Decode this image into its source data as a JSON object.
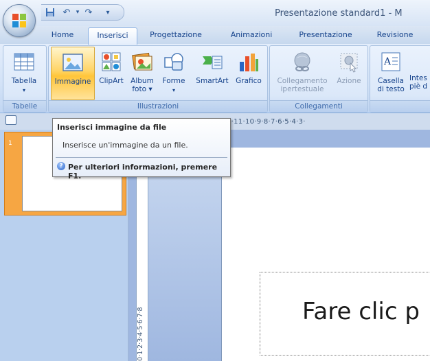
{
  "window": {
    "title": "Presentazione standard1 - M"
  },
  "tabs": [
    {
      "label": "Home"
    },
    {
      "label": "Inserisci",
      "active": true
    },
    {
      "label": "Progettazione"
    },
    {
      "label": "Animazioni"
    },
    {
      "label": "Presentazione"
    },
    {
      "label": "Revisione"
    }
  ],
  "ribbon": {
    "groups": {
      "tabelle": {
        "label": "Tabelle",
        "buttons": {
          "tabella": "Tabella"
        }
      },
      "illustrazioni": {
        "label": "Illustrazioni",
        "buttons": {
          "immagine": "Immagine",
          "clipart": "ClipArt",
          "album_1": "Album",
          "album_2": "foto ▾",
          "forme": "Forme",
          "smartart": "SmartArt",
          "grafico": "Grafico"
        }
      },
      "collegamenti": {
        "label": "Collegamenti",
        "buttons": {
          "collegamento_1": "Collegamento",
          "collegamento_2": "ipertestuale",
          "azione": "Azione"
        }
      },
      "testo": {
        "buttons": {
          "casella_1": "Casella",
          "casella_2": "di testo",
          "intest_1": "Intes",
          "intest_2": "piè d"
        }
      }
    }
  },
  "ruler": {
    "horizontal": "2·11·10·9·8·7·6·5·4·3·",
    "vertical": "0·1·2·3·4·5·6·7·8"
  },
  "slides_panel": {
    "slide_number": "1"
  },
  "slide": {
    "title_placeholder": "Fare clic p"
  },
  "tooltip": {
    "title": "Inserisci immagine da file",
    "description": "Inserisce un'immagine da un file.",
    "help": "Per ulteriori informazioni, premere F1."
  },
  "colors": {
    "ribbon_text": "#15428b",
    "highlight": "#ffd466",
    "slide_selected": "#f6a643"
  }
}
